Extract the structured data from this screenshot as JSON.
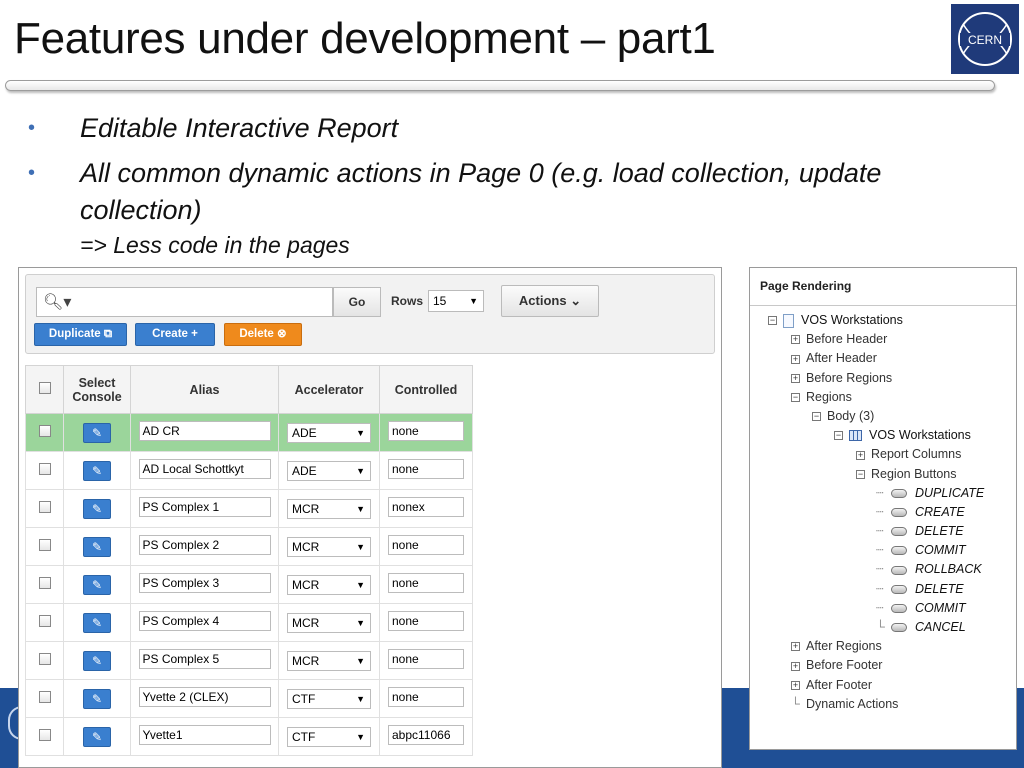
{
  "slide": {
    "title": "Features under development – part1",
    "logo": "CERN",
    "bullets": [
      {
        "text": "Editable Interactive Report"
      },
      {
        "text": "All common dynamic actions in Page 0 (e.g. load collection, update collection)",
        "sub": "=> Less code in the pages"
      }
    ]
  },
  "report": {
    "search_placeholder": "",
    "search_icon": "search-icon",
    "go_label": "Go",
    "rows_label": "Rows",
    "rows_value": "15",
    "actions_label": "Actions",
    "buttons": {
      "duplicate": "Duplicate",
      "create": "Create",
      "delete": "Delete"
    },
    "columns": [
      "Select Console",
      "Alias",
      "Accelerator",
      "Controlled"
    ],
    "rows": [
      {
        "alias": "AD CR",
        "accelerator": "ADE",
        "controlled": "none"
      },
      {
        "alias": "AD Local Schottkyt",
        "accelerator": "ADE",
        "controlled": "none"
      },
      {
        "alias": "PS Complex 1",
        "accelerator": "MCR",
        "controlled": "nonex"
      },
      {
        "alias": "PS Complex 2",
        "accelerator": "MCR",
        "controlled": "none"
      },
      {
        "alias": "PS Complex 3",
        "accelerator": "MCR",
        "controlled": "none"
      },
      {
        "alias": "PS Complex 4",
        "accelerator": "MCR",
        "controlled": "none"
      },
      {
        "alias": "PS Complex 5",
        "accelerator": "MCR",
        "controlled": "none"
      },
      {
        "alias": "Yvette 2 (CLEX)",
        "accelerator": "CTF",
        "controlled": "none"
      },
      {
        "alias": "Yvette1",
        "accelerator": "CTF",
        "controlled": "abpc11066"
      }
    ],
    "highlight_color": "#9bd59b"
  },
  "tree": {
    "header": "Page Rendering",
    "nodes": [
      "VOS Workstations",
      "Before Header",
      "After Header",
      "Before Regions",
      "Regions",
      "Body (3)",
      "VOS Workstations",
      "Report Columns",
      "Region Buttons",
      "DUPLICATE",
      "CREATE",
      "DELETE",
      "COMMIT",
      "ROLLBACK",
      "DELETE",
      "COMMIT",
      "CANCEL",
      "After Regions",
      "Before Footer",
      "After Footer",
      "Dynamic Actions"
    ]
  },
  "colors": {
    "accent_blue": "#3a7fcf",
    "delete_orange": "#ef8a1c",
    "footer_blue": "#1f4f95"
  }
}
